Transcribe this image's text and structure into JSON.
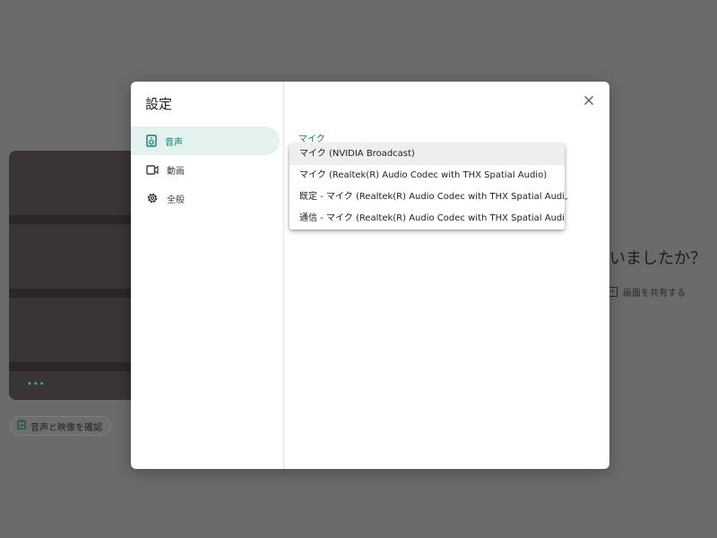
{
  "background": {
    "check_av_label": "音声と映像を確認",
    "heading_partial": "いましたか？",
    "share_screen_label": "画面を共有する",
    "video_indicator": "•••"
  },
  "dialog": {
    "title": "設定",
    "nav": [
      {
        "label": "音声",
        "icon": "speaker-icon",
        "active": true
      },
      {
        "label": "動画",
        "icon": "video-camera-icon",
        "active": false
      },
      {
        "label": "全般",
        "icon": "gear-icon",
        "active": false
      }
    ],
    "microphone": {
      "label": "マイク",
      "options": [
        "マイク (NVIDIA Broadcast)",
        "マイク (Realtek(R) Audio Codec with THX Spatial Audio)",
        "既定 - マイク (Realtek(R) Audio Codec with THX Spatial Audio)",
        "通信 - マイク (Realtek(R) Audio Codec with THX Spatial Audio)"
      ],
      "highlighted_index": 0
    }
  },
  "colors": {
    "accent": "#137d6b",
    "active_nav_bg": "#e3f2ef",
    "scrim": "#6b6b6b"
  }
}
